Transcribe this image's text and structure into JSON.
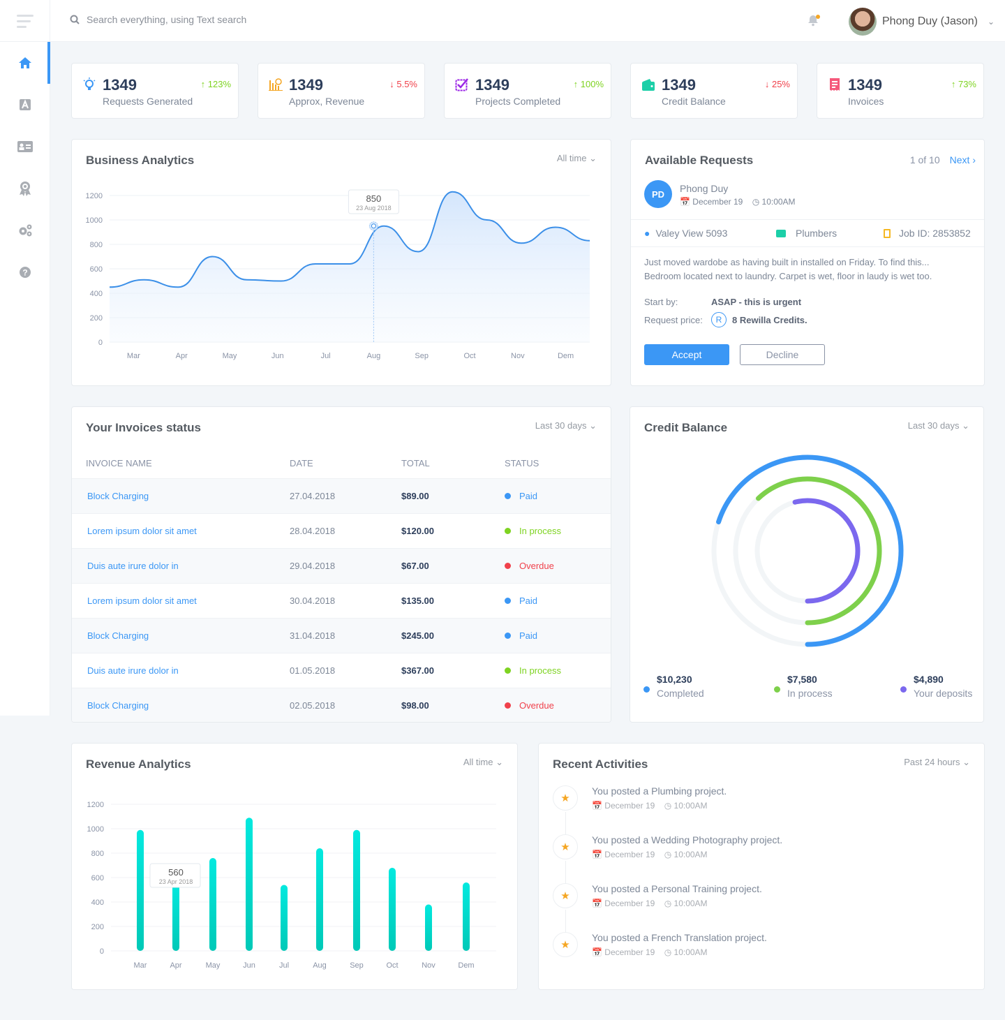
{
  "header": {
    "search_placeholder": "Search everything, using Text search",
    "user_name": "Phong Duy (Jason)"
  },
  "sidebar": {
    "items": [
      {
        "name": "home",
        "icon": "home-icon"
      },
      {
        "name": "apps",
        "icon": "app-icon"
      },
      {
        "name": "contacts",
        "icon": "id-card-icon"
      },
      {
        "name": "awards",
        "icon": "badge-icon"
      },
      {
        "name": "settings",
        "icon": "gears-icon"
      },
      {
        "name": "help",
        "icon": "help-icon"
      }
    ]
  },
  "stats": [
    {
      "value": "1349",
      "label": "Requests Generated",
      "change": "123%",
      "direction": "up",
      "icon": "lightbulb-icon",
      "color": "#3b97f5"
    },
    {
      "value": "1349",
      "label": "Approx, Revenue",
      "change": "5.5%",
      "direction": "down",
      "icon": "chart-icon",
      "color": "#f5a623"
    },
    {
      "value": "1349",
      "label": "Projects Completed",
      "change": "100%",
      "direction": "up",
      "icon": "checkbox-icon",
      "color": "#9b26e6"
    },
    {
      "value": "1349",
      "label": "Credit Balance",
      "change": "25%",
      "direction": "down",
      "icon": "wallet-icon",
      "color": "#1ccfa8"
    },
    {
      "value": "1349",
      "label": "Invoices",
      "change": "73%",
      "direction": "up",
      "icon": "receipt-icon",
      "color": "#f5587b"
    }
  ],
  "business": {
    "title": "Business Analytics",
    "filter": "All time",
    "tooltip_value": "850",
    "tooltip_date": "23 Aug 2018"
  },
  "requests": {
    "title": "Available Requests",
    "pager": "1 of 10",
    "next": "Next",
    "initials": "PD",
    "name": "Phong Duy",
    "date": "December 19",
    "time": "10:00AM",
    "location": "Valey View 5093",
    "category": "Plumbers",
    "job_id": "Job ID: 2853852",
    "description": "Just moved wardobe as having built in installed on Friday. To find this... Bedroom located next to laundry. Carpet is wet, floor in laudy is wet too.",
    "start_label": "Start by:",
    "start_value": "ASAP - this is urgent",
    "price_label": "Request price:",
    "price_value": "8 Rewilla Credits.",
    "accept": "Accept",
    "decline": "Decline"
  },
  "invoices": {
    "title": "Your Invoices status",
    "filter": "Last 30 days",
    "headers": [
      "INVOICE NAME",
      "DATE",
      "TOTAL",
      "STATUS"
    ],
    "rows": [
      {
        "name": "Block Charging",
        "date": "27.04.2018",
        "total": "$89.00",
        "status": "Paid"
      },
      {
        "name": "Lorem ipsum dolor sit amet",
        "date": "28.04.2018",
        "total": "$120.00",
        "status": "In process"
      },
      {
        "name": "Duis aute irure dolor in",
        "date": "29.04.2018",
        "total": "$67.00",
        "status": "Overdue"
      },
      {
        "name": "Lorem ipsum dolor sit amet",
        "date": "30.04.2018",
        "total": "$135.00",
        "status": "Paid"
      },
      {
        "name": "Block Charging",
        "date": "31.04.2018",
        "total": "$245.00",
        "status": "Paid"
      },
      {
        "name": "Duis aute irure dolor in",
        "date": "01.05.2018",
        "total": "$367.00",
        "status": "In process"
      },
      {
        "name": "Block Charging",
        "date": "02.05.2018",
        "total": "$98.00",
        "status": "Overdue"
      }
    ],
    "status_colors": {
      "Paid": "#3b97f5",
      "In process": "#7ed321",
      "Overdue": "#f0414b"
    }
  },
  "credit": {
    "title": "Credit Balance",
    "filter": "Last 30 days",
    "items": [
      {
        "value": "$10,230",
        "label": "Completed",
        "color": "#3b97f5"
      },
      {
        "value": "$7,580",
        "label": "In process",
        "color": "#7ed04b"
      },
      {
        "value": "$4,890",
        "label": "Your deposits",
        "color": "#7b68ee"
      }
    ]
  },
  "revenue": {
    "title": "Revenue Analytics",
    "filter": "All time",
    "tooltip_value": "560",
    "tooltip_date": "23 Apr 2018"
  },
  "activities": {
    "title": "Recent Activities",
    "filter": "Past 24 hours",
    "items": [
      {
        "text": "You posted a Plumbing project.",
        "date": "December 19",
        "time": "10:00AM"
      },
      {
        "text": "You posted a Wedding Photography project.",
        "date": "December 19",
        "time": "10:00AM"
      },
      {
        "text": "You posted a Personal Training project.",
        "date": "December 19",
        "time": "10:00AM"
      },
      {
        "text": "You posted a French Translation project.",
        "date": "December 19",
        "time": "10:00AM"
      }
    ]
  },
  "chart_data": [
    {
      "type": "area",
      "title": "Business Analytics",
      "categories": [
        "Mar",
        "Apr",
        "May",
        "Jun",
        "Jul",
        "Aug",
        "Sep",
        "Oct",
        "Nov",
        "Dem"
      ],
      "x": [
        0,
        0.5,
        1,
        1.5,
        2,
        2.5,
        3,
        3.5,
        4,
        4.5,
        5,
        5.2,
        5.5,
        6,
        6.5,
        7,
        7.5,
        8,
        8.5,
        9,
        9.5
      ],
      "values": [
        450,
        510,
        450,
        700,
        510,
        500,
        640,
        640,
        950,
        740,
        1230,
        1000,
        810,
        940,
        830
      ],
      "ylim": [
        0,
        1200
      ],
      "yticks": [
        0,
        200,
        400,
        600,
        800,
        1000,
        1200
      ],
      "xlabel": "",
      "ylabel": "",
      "grid": true,
      "annotation": {
        "category": "Aug",
        "value": 850,
        "label": "23 Aug 2018"
      }
    },
    {
      "type": "bar",
      "title": "Revenue Analytics",
      "categories": [
        "Mar",
        "Apr",
        "May",
        "Jun",
        "Jul",
        "Aug",
        "Sep",
        "Oct",
        "Nov",
        "Dem"
      ],
      "values": [
        990,
        560,
        760,
        1090,
        540,
        840,
        990,
        680,
        380,
        560
      ],
      "ylim": [
        0,
        1200
      ],
      "yticks": [
        0,
        200,
        400,
        600,
        800,
        1000,
        1200
      ],
      "grid": true,
      "annotation": {
        "category": "Apr",
        "value": 560,
        "label": "23 Apr 2018"
      }
    },
    {
      "type": "radial-bar",
      "title": "Credit Balance",
      "categories": [
        "Completed",
        "In process",
        "Your deposits"
      ],
      "values": [
        10230,
        7580,
        4890
      ],
      "fractions": [
        0.7,
        0.62,
        0.54
      ]
    }
  ]
}
